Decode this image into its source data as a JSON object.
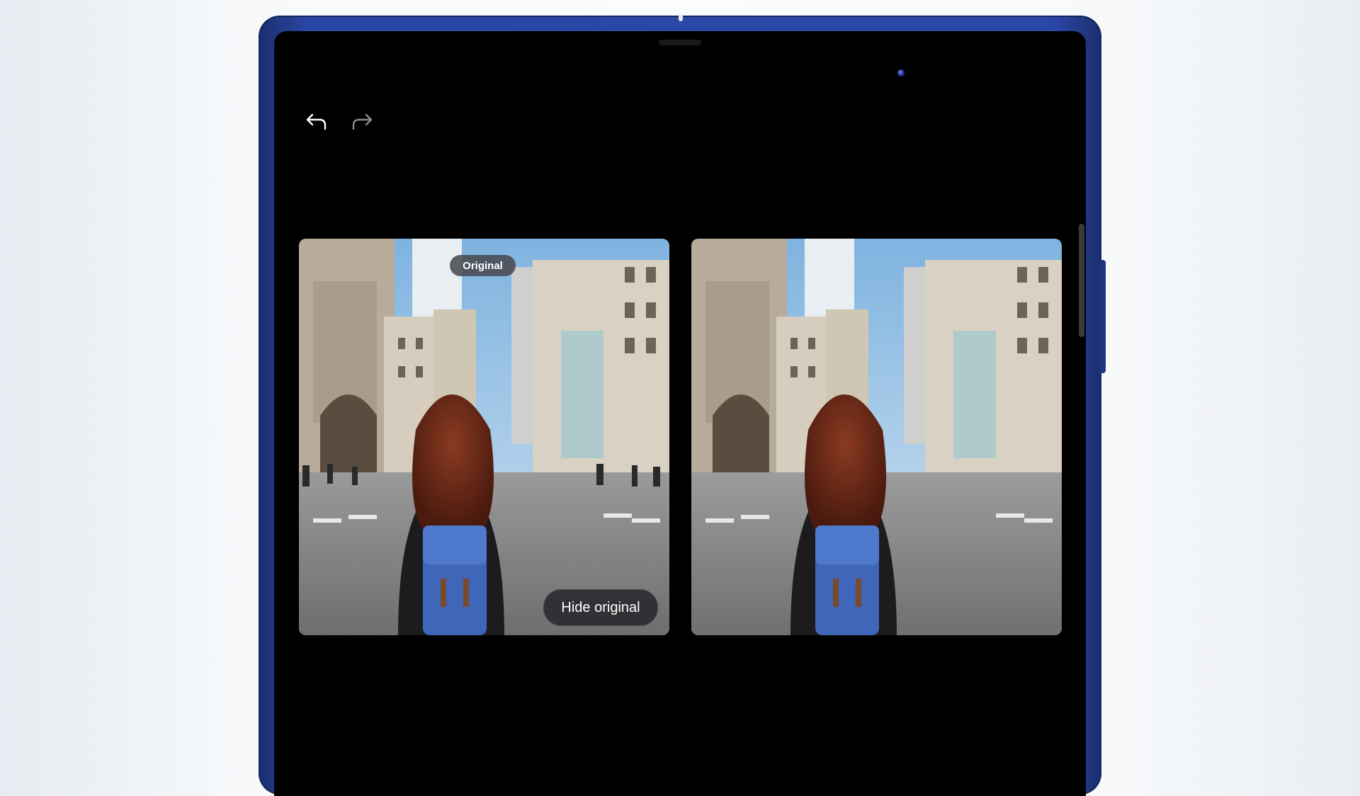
{
  "toolbar": {
    "undo_icon": "undo-arrow-icon",
    "redo_icon": "redo-arrow-icon"
  },
  "compare": {
    "original_label": "Original",
    "hide_original_label": "Hide original"
  },
  "colors": {
    "device_frame": "#2b48a8",
    "screen_bg": "#000000",
    "pill_bg": "#46464c"
  }
}
